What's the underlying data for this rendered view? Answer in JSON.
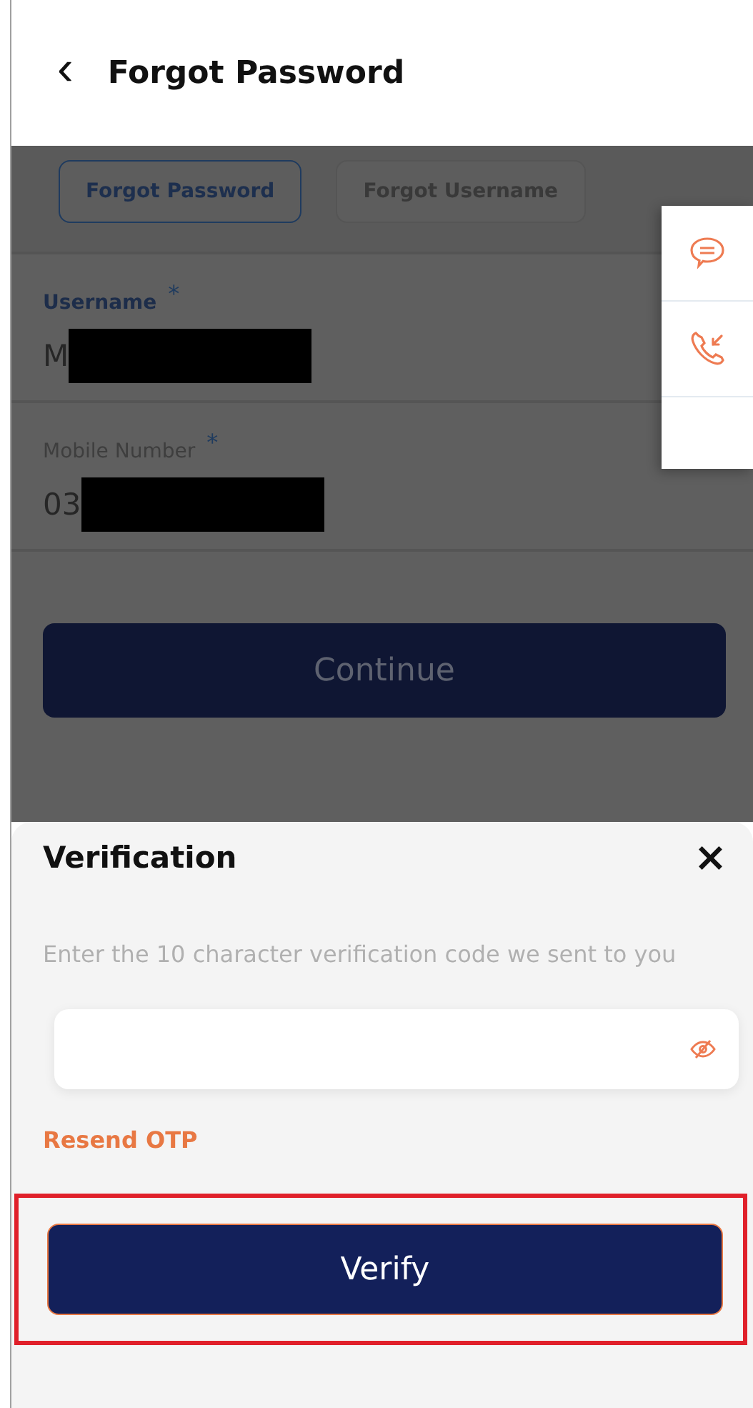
{
  "header": {
    "back_icon": "‹",
    "title": "Forgot Password"
  },
  "tabs": [
    {
      "label": "Forgot Password",
      "selected": true
    },
    {
      "label": "Forgot Username",
      "selected": false
    }
  ],
  "fields": [
    {
      "label": "Username",
      "required_mark": "*",
      "value": "M",
      "focused": true
    },
    {
      "label": "Mobile Number",
      "required_mark": "*",
      "value": "03",
      "focused": false
    }
  ],
  "continue_button": "Continue",
  "side_panel": [
    {
      "kind": "chat"
    },
    {
      "kind": "call"
    },
    {
      "kind": "empty"
    }
  ],
  "sheet": {
    "title": "Verification",
    "close": "×",
    "description": "Enter the 10 character verification code we sent to you",
    "code_field": {
      "masked": true
    },
    "resend_link": "Resend OTP",
    "verify_button": "Verify",
    "highlighted": true
  }
}
